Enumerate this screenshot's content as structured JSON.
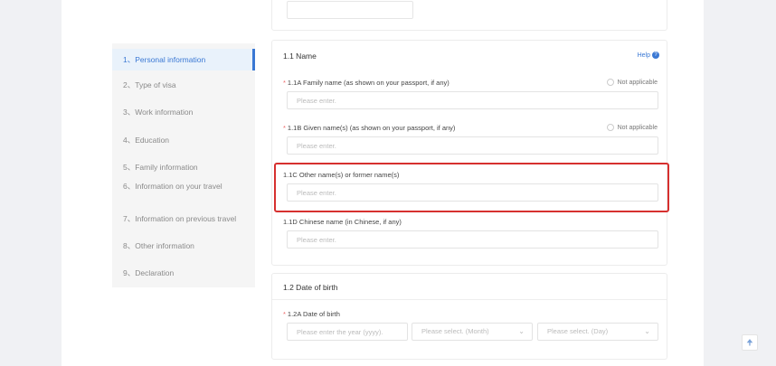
{
  "sidebar": {
    "items": [
      {
        "label": "1、Personal information",
        "active": true
      },
      {
        "label": "2、Type of visa"
      },
      {
        "label": "3、Work information"
      },
      {
        "label": "4、Education"
      },
      {
        "label": "5、Family information"
      },
      {
        "label": "6、Information on your travel"
      },
      {
        "label": "7、Information on previous travel"
      },
      {
        "label": "8、Other information"
      },
      {
        "label": "9、Declaration"
      }
    ]
  },
  "name_section": {
    "title": "1.1 Name",
    "help_label": "Help",
    "help_icon": "question-circle-icon",
    "fields": [
      {
        "label": "1.1A Family name (as shown on your passport, if any)",
        "required": "*",
        "placeholder": "Please enter.",
        "not_applicable": "Not applicable"
      },
      {
        "label": "1.1B Given name(s) (as shown on your passport, if any)",
        "required": "*",
        "placeholder": "Please enter.",
        "not_applicable": "Not applicable"
      },
      {
        "label": "1.1C Other name(s) or former name(s)",
        "placeholder": "Please enter."
      },
      {
        "label": "1.1D Chinese name (in Chinese, if any)",
        "placeholder": "Please enter."
      }
    ]
  },
  "dob_section": {
    "title": "1.2 Date of birth",
    "field_label": "1.2A Date of birth",
    "required": "*",
    "year_placeholder": "Please enter the year (yyyy).",
    "month_placeholder": "Please select. (Month)",
    "day_placeholder": "Please select. (Day)"
  },
  "scroll_top_icon": "arrow-up-icon",
  "colors": {
    "accent": "#3a78d4",
    "highlight": "#d6302f"
  }
}
